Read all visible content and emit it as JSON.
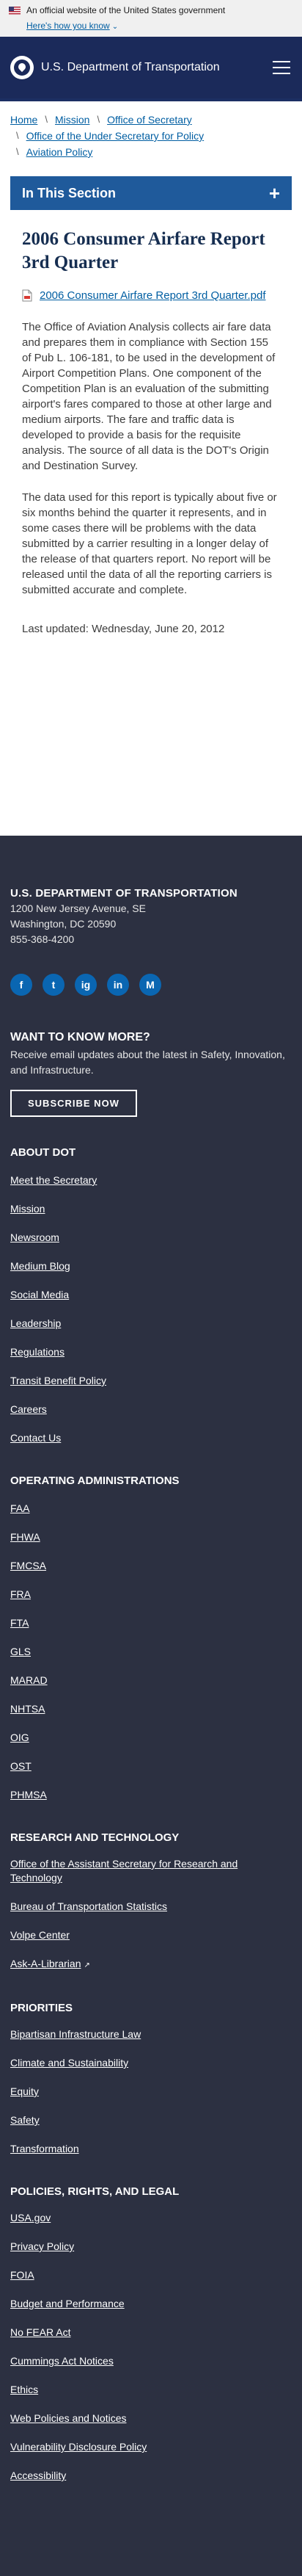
{
  "gov_banner": {
    "text": "An official website of the United States government",
    "link": "Here's how you know"
  },
  "header": {
    "site_name": "U.S. Department of Transportation"
  },
  "breadcrumb": {
    "items": [
      "Home",
      "Mission",
      "Office of Secretary",
      "Office of the Under Secretary for Policy",
      "Aviation Policy"
    ]
  },
  "section_nav": {
    "title": "In This Section",
    "toggle": "+"
  },
  "main": {
    "title": "2006 Consumer Airfare Report 3rd Quarter",
    "file_link": "2006 Consumer Airfare Report 3rd Quarter.pdf",
    "paragraphs": [
      "The Office of Aviation Analysis collects air fare data and prepares them in compliance with Section 155 of Pub L. 106-181, to be used in the development of Airport Competition Plans. One component of the Competition Plan is an evaluation of the submitting airport's fares compared to those at other large and medium airports. The fare and traffic data is developed to provide a basis for the requisite analysis. The source of all data is the DOT's Origin and Destination Survey.",
      "The data used for this report is typically about five or six months behind the quarter it represents, and in some cases there will be problems with the data submitted by a carrier resulting in a longer delay of the release of that quarters report. No report will be released until the data of all the reporting carriers is submitted accurate and complete."
    ],
    "last_updated": "Last updated: Wednesday, June 20, 2012"
  },
  "footer": {
    "org_name": "U.S. DEPARTMENT OF TRANSPORTATION",
    "address_line1": "1200 New Jersey Avenue, SE",
    "address_line2": "Washington, DC 20590",
    "phone": "855-368-4200",
    "social": [
      "f",
      "t",
      "ig",
      "in",
      "M"
    ],
    "newsletter_heading": "WANT TO KNOW MORE?",
    "newsletter_text": "Receive email updates about the latest in Safety, Innovation, and Infrastructure.",
    "subscribe_label": "SUBSCRIBE NOW",
    "about_heading": "ABOUT DOT",
    "about_links": [
      "Meet the Secretary",
      "Mission",
      "Newsroom",
      "Medium Blog",
      "Social Media",
      "Leadership",
      "Regulations",
      "Transit Benefit Policy",
      "Careers",
      "Contact Us"
    ],
    "opadmin_heading": "OPERATING ADMINISTRATIONS",
    "opadmin_links": [
      "FAA",
      "FHWA",
      "FMCSA",
      "FRA",
      "FTA",
      "GLS",
      "MARAD",
      "NHTSA",
      "OIG",
      "OST",
      "PHMSA"
    ],
    "research_heading": "RESEARCH AND TECHNOLOGY",
    "research_links": [
      "Office of the Assistant Secretary for Research and Technology",
      "Bureau of Transportation Statistics",
      "Volpe Center",
      "Ask-A-Librarian"
    ],
    "priorities_heading": "PRIORITIES",
    "priorities_links": [
      "Bipartisan Infrastructure Law",
      "Climate and Sustainability",
      "Equity",
      "Safety",
      "Transformation"
    ],
    "policies_heading": "POLICIES, RIGHTS, AND LEGAL",
    "policies_links": [
      "USA.gov",
      "Privacy Policy",
      "FOIA",
      "Budget and Performance",
      "No FEAR Act",
      "Cummings Act Notices",
      "Ethics",
      "Web Policies and Notices",
      "Vulnerability Disclosure Policy",
      "Accessibility"
    ]
  }
}
